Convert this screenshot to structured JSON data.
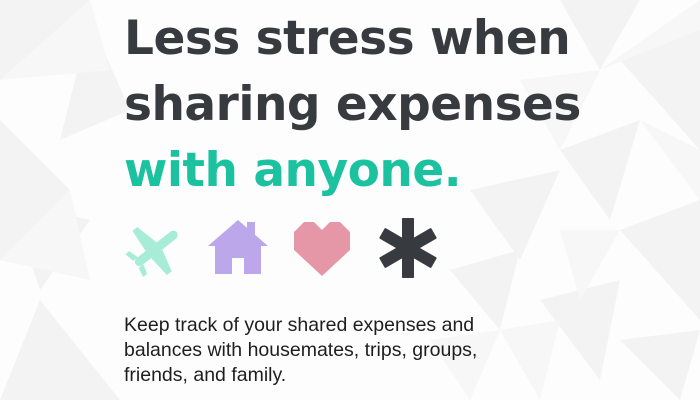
{
  "hero": {
    "headline_line1": "Less stress when",
    "headline_line2": "sharing expenses",
    "headline_line3": "with anyone.",
    "tagline": "Keep track of your shared expenses and balances with housemates, trips, groups, friends, and family."
  },
  "icons": [
    {
      "name": "airplane-icon",
      "color": "#a6ecd6"
    },
    {
      "name": "house-icon",
      "color": "#bca7ea"
    },
    {
      "name": "heart-icon",
      "color": "#e597a8"
    },
    {
      "name": "asterisk-icon",
      "color": "#373a3f"
    }
  ],
  "colors": {
    "headline_dark": "#373a3f",
    "headline_accent": "#1cc29f",
    "body_text": "#1e1e1e"
  }
}
